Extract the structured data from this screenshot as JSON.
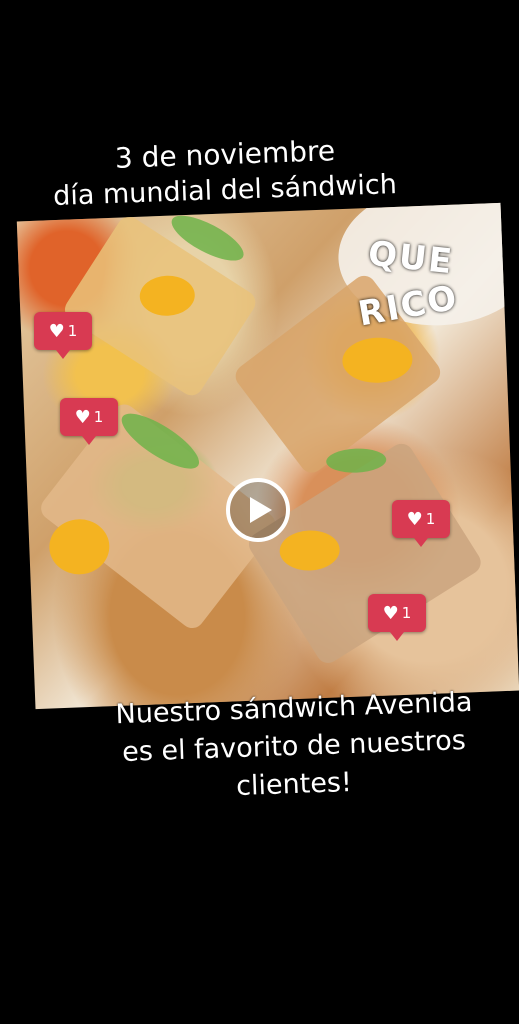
{
  "header": {
    "line1": "3 de noviembre",
    "line2": "día mundial del sándwich"
  },
  "sticker": {
    "word1": "QUE",
    "word2": "RICO"
  },
  "likes": [
    {
      "count": "1"
    },
    {
      "count": "1"
    },
    {
      "count": "1"
    },
    {
      "count": "1"
    }
  ],
  "caption": {
    "line1": "Nuestro sándwich Avenida",
    "line2": "es el favorito de nuestros",
    "line3": "clientes!"
  },
  "colors": {
    "background": "#000000",
    "like_badge": "#d83a52",
    "text": "#ffffff"
  }
}
